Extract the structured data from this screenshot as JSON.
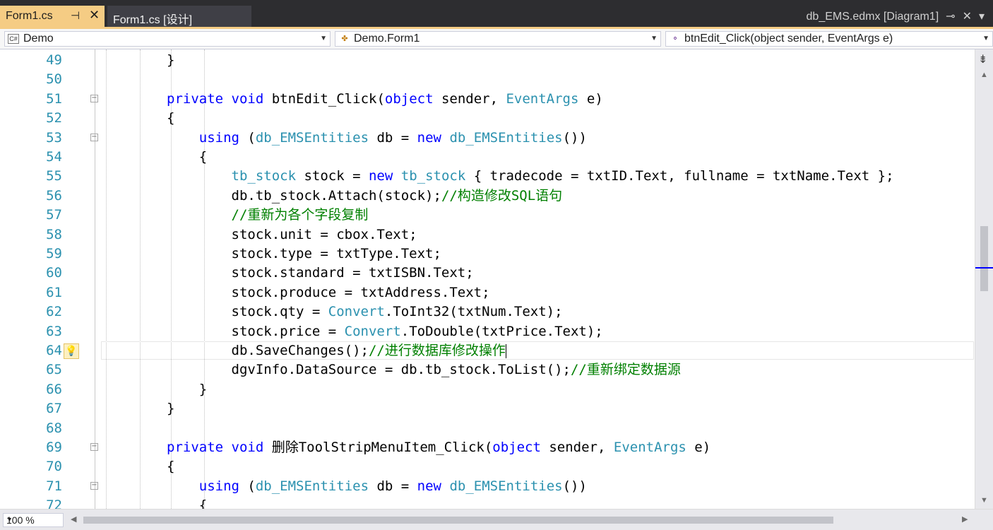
{
  "tabs": [
    {
      "label": "Form1.cs",
      "pin": "⊣",
      "close": "✕"
    },
    {
      "label": "Form1.cs [设计]"
    }
  ],
  "right_tab": {
    "label": "db_EMS.edmx [Diagram1]",
    "pin": "⊸",
    "close": "✕",
    "menu": "▾"
  },
  "nav": {
    "project": "Demo",
    "class": "Demo.Form1",
    "member": "btnEdit_Click(object sender, EventArgs e)"
  },
  "zoom": "100 %",
  "colors": {
    "keyword": "#0000ff",
    "type": "#2b91af",
    "comment": "#008000",
    "active_tab": "#f5cc84"
  },
  "lines": [
    {
      "n": "49",
      "s": [
        [
          "tx",
          "}"
        ]
      ]
    },
    {
      "n": "50",
      "s": []
    },
    {
      "n": "51",
      "s": [
        [
          "kw",
          "private"
        ],
        [
          "tx",
          " "
        ],
        [
          "kw",
          "void"
        ],
        [
          "tx",
          " btnEdit_Click("
        ],
        [
          "kw",
          "object"
        ],
        [
          "tx",
          " sender, "
        ],
        [
          "tp",
          "EventArgs"
        ],
        [
          "tx",
          " e)"
        ]
      ]
    },
    {
      "n": "52",
      "s": [
        [
          "tx",
          "{"
        ]
      ]
    },
    {
      "n": "53",
      "s": [
        [
          "tx",
          "    "
        ],
        [
          "kw",
          "using"
        ],
        [
          "tx",
          " ("
        ],
        [
          "tp",
          "db_EMSEntities"
        ],
        [
          "tx",
          " db = "
        ],
        [
          "kw",
          "new"
        ],
        [
          "tx",
          " "
        ],
        [
          "tp",
          "db_EMSEntities"
        ],
        [
          "tx",
          "())"
        ]
      ]
    },
    {
      "n": "54",
      "s": [
        [
          "tx",
          "    {"
        ]
      ]
    },
    {
      "n": "55",
      "s": [
        [
          "tx",
          "        "
        ],
        [
          "tp",
          "tb_stock"
        ],
        [
          "tx",
          " stock = "
        ],
        [
          "kw",
          "new"
        ],
        [
          "tx",
          " "
        ],
        [
          "tp",
          "tb_stock"
        ],
        [
          "tx",
          " { tradecode = txtID.Text, fullname = txtName.Text };"
        ]
      ]
    },
    {
      "n": "56",
      "s": [
        [
          "tx",
          "        db.tb_stock.Attach(stock);"
        ],
        [
          "cm",
          "//构造修改SQL语句"
        ]
      ]
    },
    {
      "n": "57",
      "s": [
        [
          "cm",
          "        //重新为各个字段复制"
        ]
      ]
    },
    {
      "n": "58",
      "s": [
        [
          "tx",
          "        stock.unit = cbox.Text;"
        ]
      ]
    },
    {
      "n": "59",
      "s": [
        [
          "tx",
          "        stock.type = txtType.Text;"
        ]
      ]
    },
    {
      "n": "60",
      "s": [
        [
          "tx",
          "        stock.standard = txtISBN.Text;"
        ]
      ]
    },
    {
      "n": "61",
      "s": [
        [
          "tx",
          "        stock.produce = txtAddress.Text;"
        ]
      ]
    },
    {
      "n": "62",
      "s": [
        [
          "tx",
          "        stock.qty = "
        ],
        [
          "tp",
          "Convert"
        ],
        [
          "tx",
          ".ToInt32(txtNum.Text);"
        ]
      ]
    },
    {
      "n": "63",
      "s": [
        [
          "tx",
          "        stock.price = "
        ],
        [
          "tp",
          "Convert"
        ],
        [
          "tx",
          ".ToDouble(txtPrice.Text);"
        ]
      ]
    },
    {
      "n": "64",
      "s": [
        [
          "tx",
          "        db.SaveChanges();"
        ],
        [
          "cm",
          "//进行数据库修改操作"
        ]
      ]
    },
    {
      "n": "65",
      "s": [
        [
          "tx",
          "        dgvInfo.DataSource = db.tb_stock.ToList();"
        ],
        [
          "cm",
          "//重新绑定数据源"
        ]
      ]
    },
    {
      "n": "66",
      "s": [
        [
          "tx",
          "    }"
        ]
      ]
    },
    {
      "n": "67",
      "s": [
        [
          "tx",
          "}"
        ]
      ]
    },
    {
      "n": "68",
      "s": []
    },
    {
      "n": "69",
      "s": [
        [
          "kw",
          "private"
        ],
        [
          "tx",
          " "
        ],
        [
          "kw",
          "void"
        ],
        [
          "tx",
          " 删除ToolStripMenuItem_Click("
        ],
        [
          "kw",
          "object"
        ],
        [
          "tx",
          " sender, "
        ],
        [
          "tp",
          "EventArgs"
        ],
        [
          "tx",
          " e)"
        ]
      ]
    },
    {
      "n": "70",
      "s": [
        [
          "tx",
          "{"
        ]
      ]
    },
    {
      "n": "71",
      "s": [
        [
          "tx",
          "    "
        ],
        [
          "kw",
          "using"
        ],
        [
          "tx",
          " ("
        ],
        [
          "tp",
          "db_EMSEntities"
        ],
        [
          "tx",
          " db = "
        ],
        [
          "kw",
          "new"
        ],
        [
          "tx",
          " "
        ],
        [
          "tp",
          "db_EMSEntities"
        ],
        [
          "tx",
          "())"
        ]
      ]
    },
    {
      "n": "72",
      "s": [
        [
          "tx",
          "    {"
        ]
      ]
    }
  ],
  "fold_lines": [
    "51",
    "53",
    "69",
    "71"
  ],
  "current_line": "64"
}
